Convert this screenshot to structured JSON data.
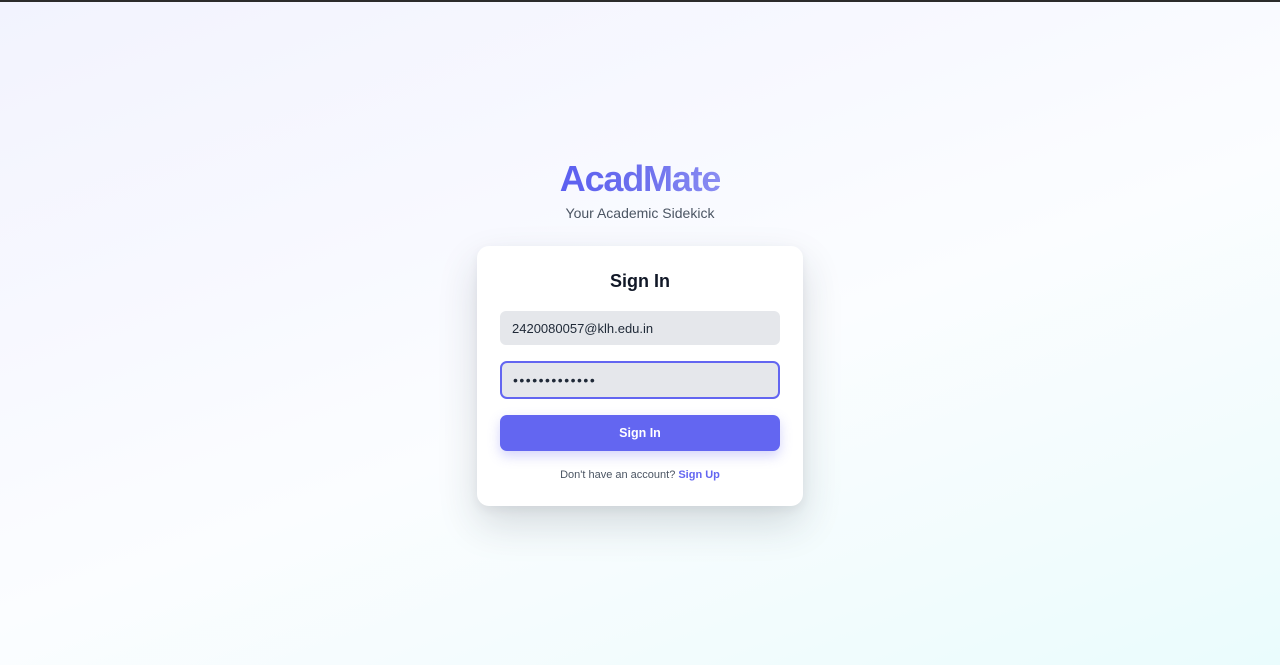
{
  "brand": {
    "title": "AcadMate",
    "subtitle": "Your Academic Sidekick"
  },
  "login_card": {
    "title": "Sign In",
    "email_value": "2420080057@klh.edu.in",
    "password_value": "•••••••••••••",
    "submit_label": "Sign In",
    "footer_text": "Don't have an account?",
    "signup_link": "Sign Up"
  },
  "colors": {
    "accent": "#6366f1",
    "input_bg": "#e5e7eb",
    "title_text": "#111827"
  }
}
